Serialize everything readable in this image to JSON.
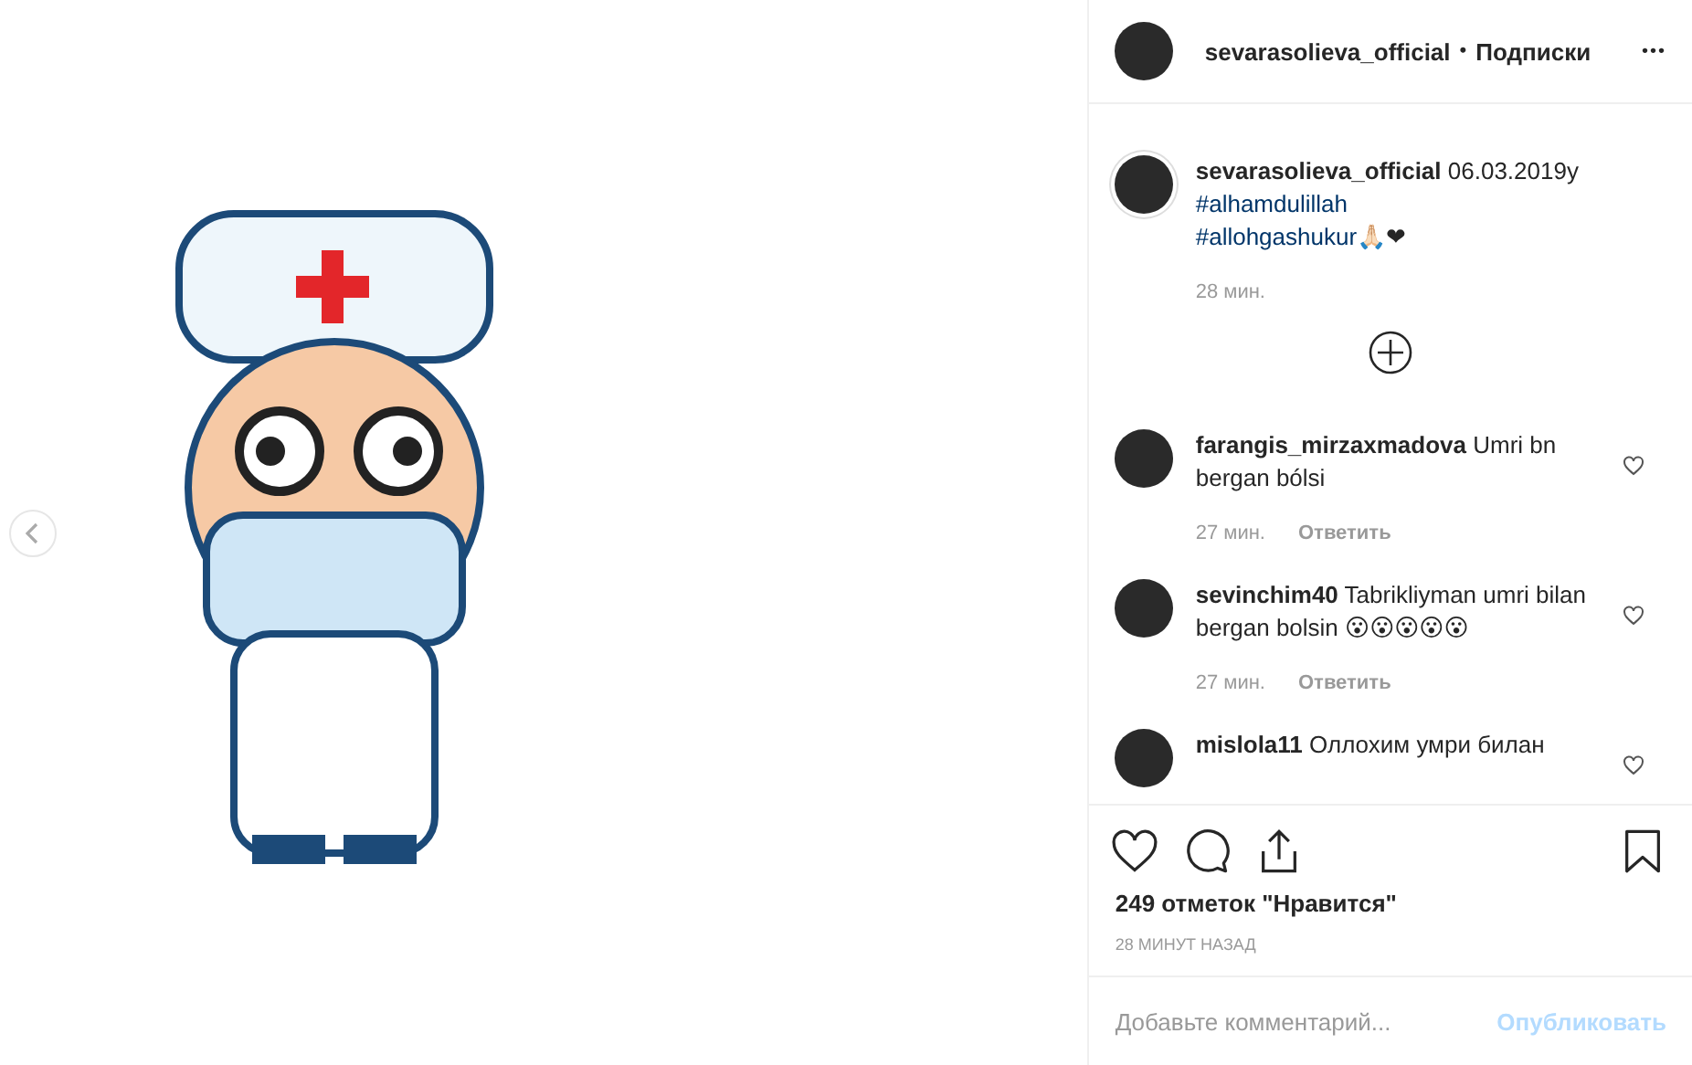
{
  "post_image": {
    "has_prev": true
  },
  "header": {
    "username": "sevarasolieva_official",
    "separator": "•",
    "follow_label": "Подписки",
    "more": "•••"
  },
  "caption": {
    "username": "sevarasolieva_official",
    "text": "06.03.2019y",
    "hashtags": [
      "#alhamdulillah",
      "#allohgashukur"
    ],
    "emoji": "🙏🏻❤",
    "time": "28 мин."
  },
  "comments": [
    {
      "username": "farangis_mirzaxmadova",
      "text": "Umri bn bergan bólsi",
      "time": "27 мин.",
      "reply": "Ответить"
    },
    {
      "username": "sevinchim40",
      "text": "Tabrikliyman umri bilan bergan bolsin 😮😮😮😮😮",
      "time": "27 мин.",
      "reply": "Ответить"
    },
    {
      "username": "mislola11",
      "text": "Оллохим умри билан"
    }
  ],
  "likes": "249 отметок \"Нравится\"",
  "posted": "28 МИНУТ НАЗАД",
  "comment_field": {
    "placeholder": "Добавьте комментарий...",
    "submit": "Опубликовать"
  }
}
